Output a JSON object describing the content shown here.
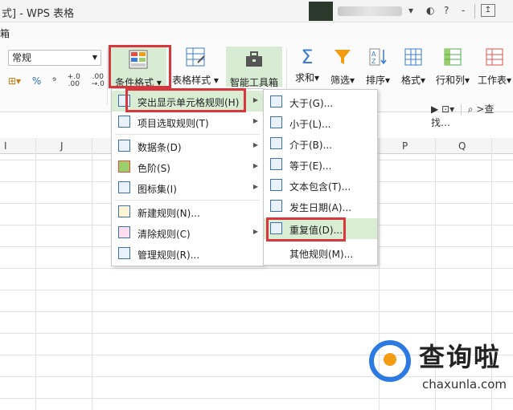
{
  "titlebar": {
    "title": "式] - WPS 表格",
    "user_icons": [
      "◐",
      "?",
      "-"
    ]
  },
  "menurow": {
    "item": "箱"
  },
  "ribbon": {
    "style_box": "常规",
    "num_buttons": [
      "%",
      "⁹",
      ".0\n.00",
      ".00\n.0"
    ],
    "cond_format": "条件格式",
    "table_style": "表格样式",
    "smart_toolbox": "智能工具箱",
    "sum": "求和",
    "filter": "筛选",
    "sort": "排序",
    "format": "格式",
    "row_col": "行和列",
    "worksheet": "工作表",
    "find": "查找"
  },
  "columns": [
    "I",
    "J",
    "P",
    "Q"
  ],
  "menu1": {
    "items": [
      {
        "label": "突出显示单元格规则(H)",
        "submenu": true
      },
      {
        "label": "项目选取规则(T)",
        "submenu": true
      },
      {
        "label": "数据条(D)",
        "submenu": true
      },
      {
        "label": "色阶(S)",
        "submenu": true
      },
      {
        "label": "图标集(I)",
        "submenu": true
      },
      {
        "label": "新建规则(N)..."
      },
      {
        "label": "清除规则(C)",
        "submenu": true
      },
      {
        "label": "管理规则(R)..."
      }
    ]
  },
  "menu2": {
    "items": [
      {
        "label": "大于(G)..."
      },
      {
        "label": "小于(L)..."
      },
      {
        "label": "介于(B)..."
      },
      {
        "label": "等于(E)..."
      },
      {
        "label": "文本包含(T)..."
      },
      {
        "label": "发生日期(A)..."
      },
      {
        "label": "重复值(D)..."
      },
      {
        "label": "其他规则(M)..."
      }
    ]
  },
  "watermark": {
    "brand": "查询啦",
    "url": "chaxunla.com"
  },
  "colors": {
    "accent_green": "#d7ecd3",
    "highlight_red": "#d9363e",
    "brand_blue": "#2d7be2",
    "brand_orange": "#f39c12"
  }
}
